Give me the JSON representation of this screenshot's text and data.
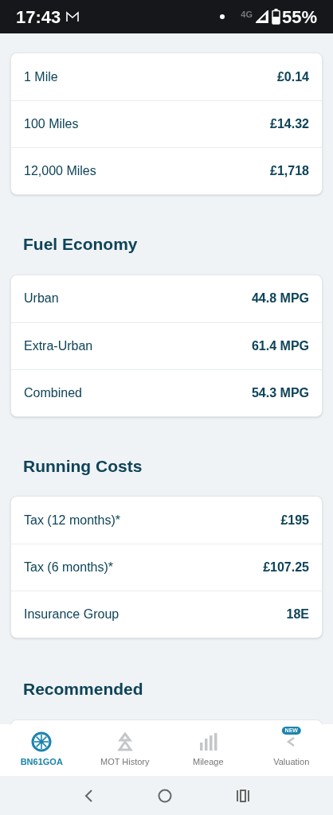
{
  "status_bar": {
    "time": "17:43",
    "network": "4G",
    "battery": "55%"
  },
  "sections": [
    {
      "rows": [
        {
          "label": "1 Mile",
          "value": "£0.14"
        },
        {
          "label": "100 Miles",
          "value": "£14.32"
        },
        {
          "label": "12,000 Miles",
          "value": "£1,718"
        }
      ]
    },
    {
      "heading": "Fuel Economy",
      "rows": [
        {
          "label": "Urban",
          "value": "44.8 MPG"
        },
        {
          "label": "Extra-Urban",
          "value": "61.4 MPG"
        },
        {
          "label": "Combined",
          "value": "54.3 MPG"
        }
      ]
    },
    {
      "heading": "Running Costs",
      "rows": [
        {
          "label": "Tax (12 months)*",
          "value": "£195"
        },
        {
          "label": "Tax (6 months)*",
          "value": "£107.25"
        },
        {
          "label": "Insurance Group",
          "value": "18E"
        }
      ]
    }
  ],
  "recommended": {
    "heading": "Recommended"
  },
  "tabs": [
    {
      "kind": "wheel",
      "label": "BN61GOA",
      "selected": true
    },
    {
      "kind": "mot",
      "label": "MOT History",
      "selected": false
    },
    {
      "kind": "mileage",
      "label": "Mileage",
      "selected": false
    },
    {
      "kind": "valuation",
      "label": "Valuation",
      "selected": false,
      "badge": "NEW"
    }
  ]
}
